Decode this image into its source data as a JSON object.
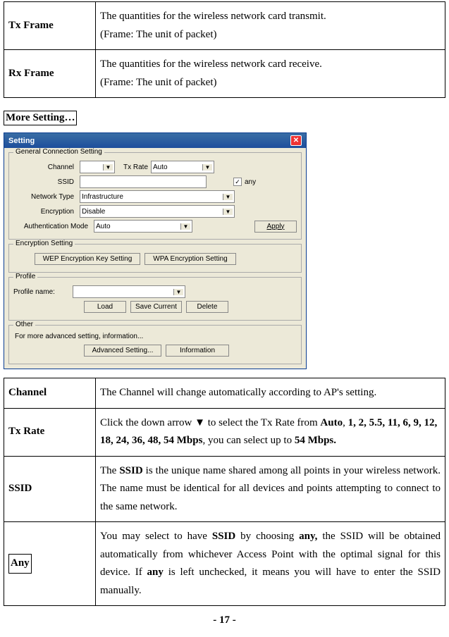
{
  "top_table": [
    {
      "label": "Tx Frame",
      "desc_l1": "The quantities for the wireless network card transmit.",
      "desc_l2": "(Frame: The unit of packet)"
    },
    {
      "label": "Rx Frame",
      "desc_l1": "The quantities for the wireless network card receive.",
      "desc_l2": "(Frame: The unit of packet)"
    }
  ],
  "heading": "More Setting…",
  "dialog": {
    "title": "Setting",
    "groups": {
      "general": {
        "title": "General Connection Setting",
        "channel_lbl": "Channel",
        "txrate_lbl": "Tx Rate",
        "txrate_val": "Auto",
        "ssid_lbl": "SSID",
        "any_lbl": "any",
        "any_checked": "✓",
        "nettype_lbl": "Network Type",
        "nettype_val": "Infrastructure",
        "enc_lbl": "Encryption",
        "enc_val": "Disable",
        "auth_lbl": "Authentication Mode",
        "auth_val": "Auto",
        "apply": "Apply"
      },
      "encryption": {
        "title": "Encryption Setting",
        "wep": "WEP Encryption Key Setting",
        "wpa": "WPA Encryption Setting"
      },
      "profile": {
        "title": "Profile",
        "name_lbl": "Profile name:",
        "load": "Load",
        "save": "Save Current",
        "delete": "Delete"
      },
      "other": {
        "title": "Other",
        "desc": "For more advanced setting, information...",
        "adv": "Advanced Setting...",
        "info": "Information"
      }
    }
  },
  "bottom_table": {
    "channel": {
      "label": "Channel",
      "desc": "The Channel will change automatically according to AP's setting."
    },
    "txrate": {
      "label": "Tx Rate",
      "p1": "Click the down arrow ▼ to select the Tx Rate from ",
      "b1": "Auto",
      "p2": ", ",
      "b2": "1, 2, 5.5, 11, 6, 9, 12, 18, 24, 36, 48, 54 Mbps",
      "p3": ", you can select up to ",
      "b3": "54 Mbps.",
      "p4": ""
    },
    "ssid": {
      "label": "SSID",
      "p1": "The ",
      "b1": "SSID",
      "p2": " is the unique name shared among all points in your wireless network. The name must be identical for all devices and points attempting to connect to the same network."
    },
    "any": {
      "label": "Any",
      "p1": "You may select to have ",
      "b1": "SSID",
      "p2": " by choosing ",
      "b2": "any,",
      "p3": " the SSID will be obtained automatically from whichever Access Point with the optimal signal for this device. If ",
      "b3": "any",
      "p4": " is left unchecked, it means you will have to enter the SSID manually."
    }
  },
  "page_number": "- 17 -"
}
